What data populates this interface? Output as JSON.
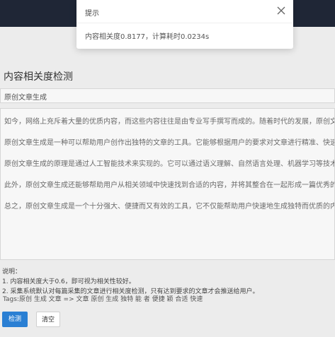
{
  "topbar": {
    "nav_left": "",
    "nav_right": ""
  },
  "page": {
    "title": "内容相关度检测",
    "title_input_value": "原创文章生成",
    "paragraphs": [
      "如今，网络上充斥着大量的优质内容，而这些内容往往是由专业写手撰写而成的。随着时代的发展，原创文章也变得越来越重要，还要有独特性，才能在众多竞争者中脱颖而出。",
      "原创文章生成是一种可以帮助用户创作出独特的文章的工具。它能够根据用户的要求对文章进行精准、快速的生成，并且它是一个非常便捷、有效的文章创作工具，可以大大提高用户的工作效率。",
      "原创文章生成的原理是通过人工智能技术来实现的。它可以通过语义理解、自然语言处理、机器学习等技术来分析用户的需求，并将其转化为独特、有意义的内容。同时，它还能够根据用户已有文章中出现过的词语、句子和表达方式，来生成别致的新内容。",
      "此外，原创文章生成还能够帮助用户从相关领域中快速找到合适的内容，并将其整合在一起形成一篇优秀的原创文章，将文章进行重写和修改，原创文章生成也能帮助他们快速而准确地实现这一目标。",
      "总之，原创文章生成是一个十分强大、便捷而又有效的工具，它不仅能帮助用户快速地生成独特而优质的内容，同时还能通过的信息来整合形成一篇优秀的原创文章。因此，使用原创文章生成工具对于想要在众多竞争者中脱颖而出并发布优质"
    ],
    "notes_title": "说明：",
    "notes": [
      "1. 内容相关度大于0.6，即可视为相关性较好。",
      "2. 采集系统默认对每篇采集的文章进行相关度检测，只有达到要求的文章才会推送给用户。"
    ],
    "tags": "Tags:原创 生成 文章 => 文章 原创 生成 独特 能 者 便捷 颖 合适 快速",
    "detect_button": "检测",
    "clear_button": "清空"
  },
  "dialog": {
    "title": "提示",
    "message": "内容相关度0.8177，计算耗时0.0234s",
    "close_icon": "close-icon"
  }
}
